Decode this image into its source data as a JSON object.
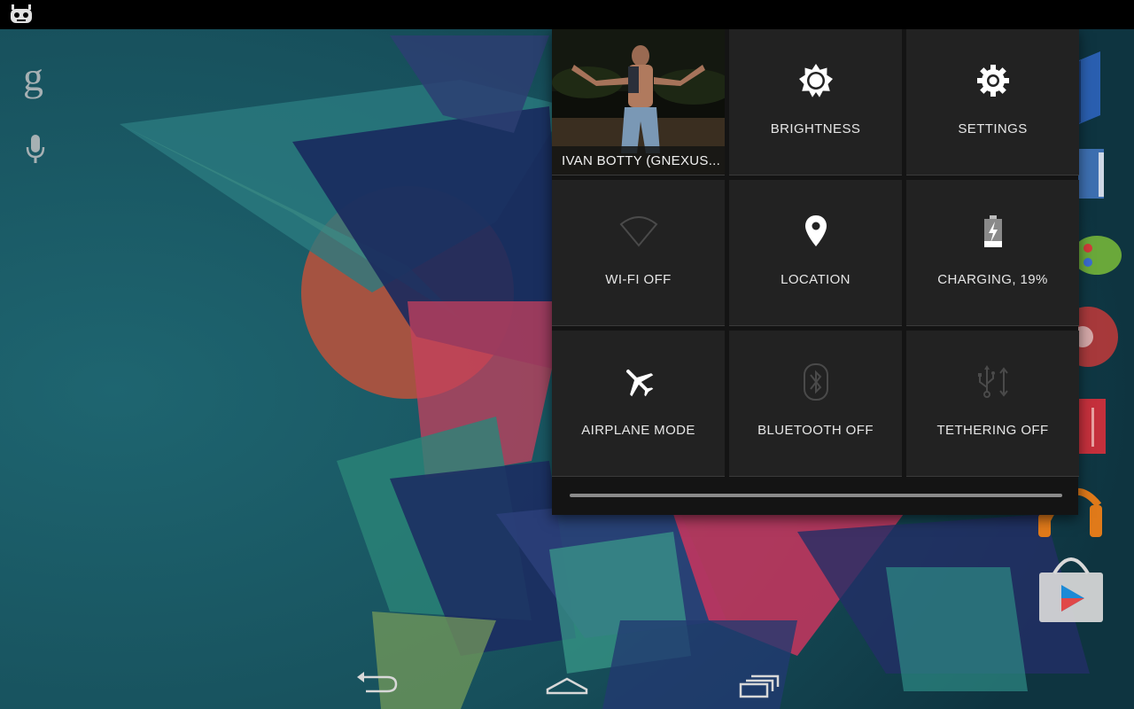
{
  "status_bar": {
    "left_icon": "cyanogenmod-icon"
  },
  "home": {
    "search_icon": "google-g-icon",
    "search_glyph": "g",
    "voice_icon": "microphone-icon",
    "dock_icons": [
      "blue-book-app-icon",
      "books-app-icon",
      "games-controller-icon",
      "music-app-icon",
      "magazine-app-icon",
      "play-music-headphones-icon",
      "play-store-icon"
    ]
  },
  "quick_settings": {
    "user_tile": {
      "name": "IVAN BOTTY (GNEXUS..."
    },
    "tiles": [
      {
        "label": "BRIGHTNESS",
        "icon": "brightness-icon"
      },
      {
        "label": "SETTINGS",
        "icon": "settings-gear-icon"
      },
      {
        "label": "WI-FI OFF",
        "icon": "wifi-off-icon"
      },
      {
        "label": "LOCATION",
        "icon": "location-pin-icon"
      },
      {
        "label": "CHARGING, 19%",
        "icon": "battery-charging-icon"
      },
      {
        "label": "AIRPLANE MODE",
        "icon": "airplane-icon"
      },
      {
        "label": "BLUETOOTH OFF",
        "icon": "bluetooth-off-icon"
      },
      {
        "label": "TETHERING OFF",
        "icon": "usb-tethering-icon"
      }
    ]
  },
  "nav_bar": {
    "buttons": [
      "back-icon",
      "home-icon",
      "recent-apps-icon"
    ]
  },
  "colors": {
    "panel_bg": "#141414",
    "tile_bg": "#222222",
    "label": "#e6e6e6",
    "wallpaper_base": "#1c5a63"
  }
}
